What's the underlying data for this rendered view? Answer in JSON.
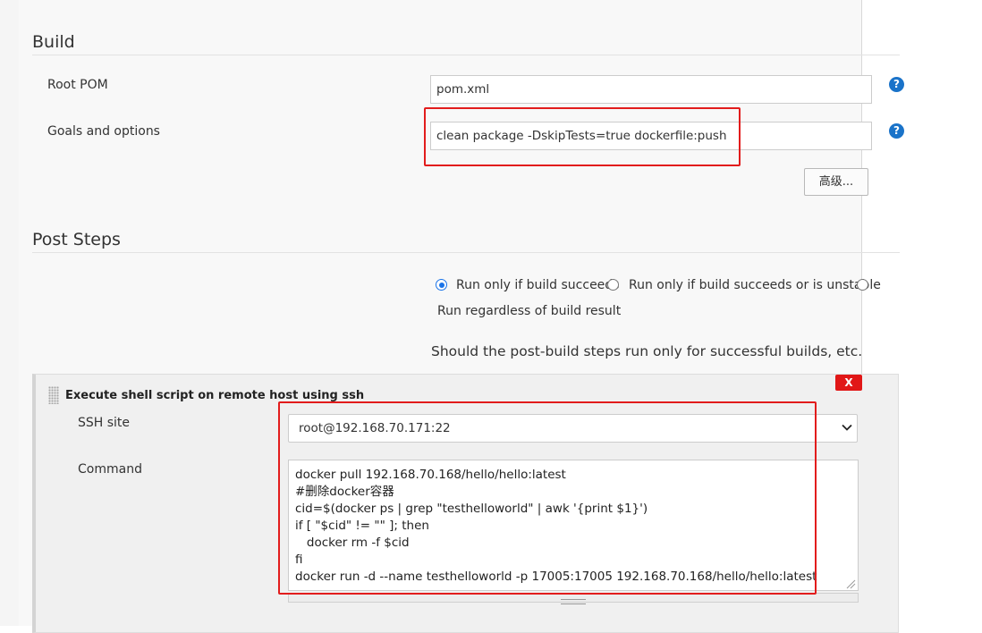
{
  "build": {
    "title": "Build",
    "root_pom_label": "Root POM",
    "root_pom_value": "pom.xml",
    "goals_label": "Goals and options",
    "goals_value": "clean package -DskipTests=true dockerfile:push",
    "help_icon": "?",
    "advanced_button": "高级..."
  },
  "post_steps": {
    "title": "Post Steps",
    "options": [
      {
        "label": "Run only if build succeeds",
        "selected": true
      },
      {
        "label": "Run only if build succeeds or is unstable",
        "selected": false
      },
      {
        "label": "Run regardless of build result",
        "selected": false
      }
    ],
    "description": "Should the post-build steps run only for successful builds, etc."
  },
  "ssh_step": {
    "title": "Execute shell script on remote host using ssh",
    "delete_label": "X",
    "ssh_site_label": "SSH site",
    "ssh_site_value": "root@192.168.70.171:22",
    "command_label": "Command",
    "command_lines": [
      "docker pull 192.168.70.168/hello/hello:latest",
      "#删除docker容器",
      "cid=$(docker ps | grep \"testhelloworld\" | awk '{print $1}')",
      "if [ \"$cid\" != \"\" ]; then",
      "   docker rm -f $cid",
      "fi",
      "docker run -d --name testhelloworld -p 17005:17005 192.168.70.168/hello/hello:latest"
    ]
  },
  "colors": {
    "help_icon": "#1a73c9",
    "delete_button": "#e11717",
    "highlight_box": "#e21c1c",
    "radio_selected": "#1a73e8"
  },
  "icons": [
    "help-icon",
    "chevron-down-icon",
    "drag-handle-icon",
    "resize-grip-icon"
  ]
}
